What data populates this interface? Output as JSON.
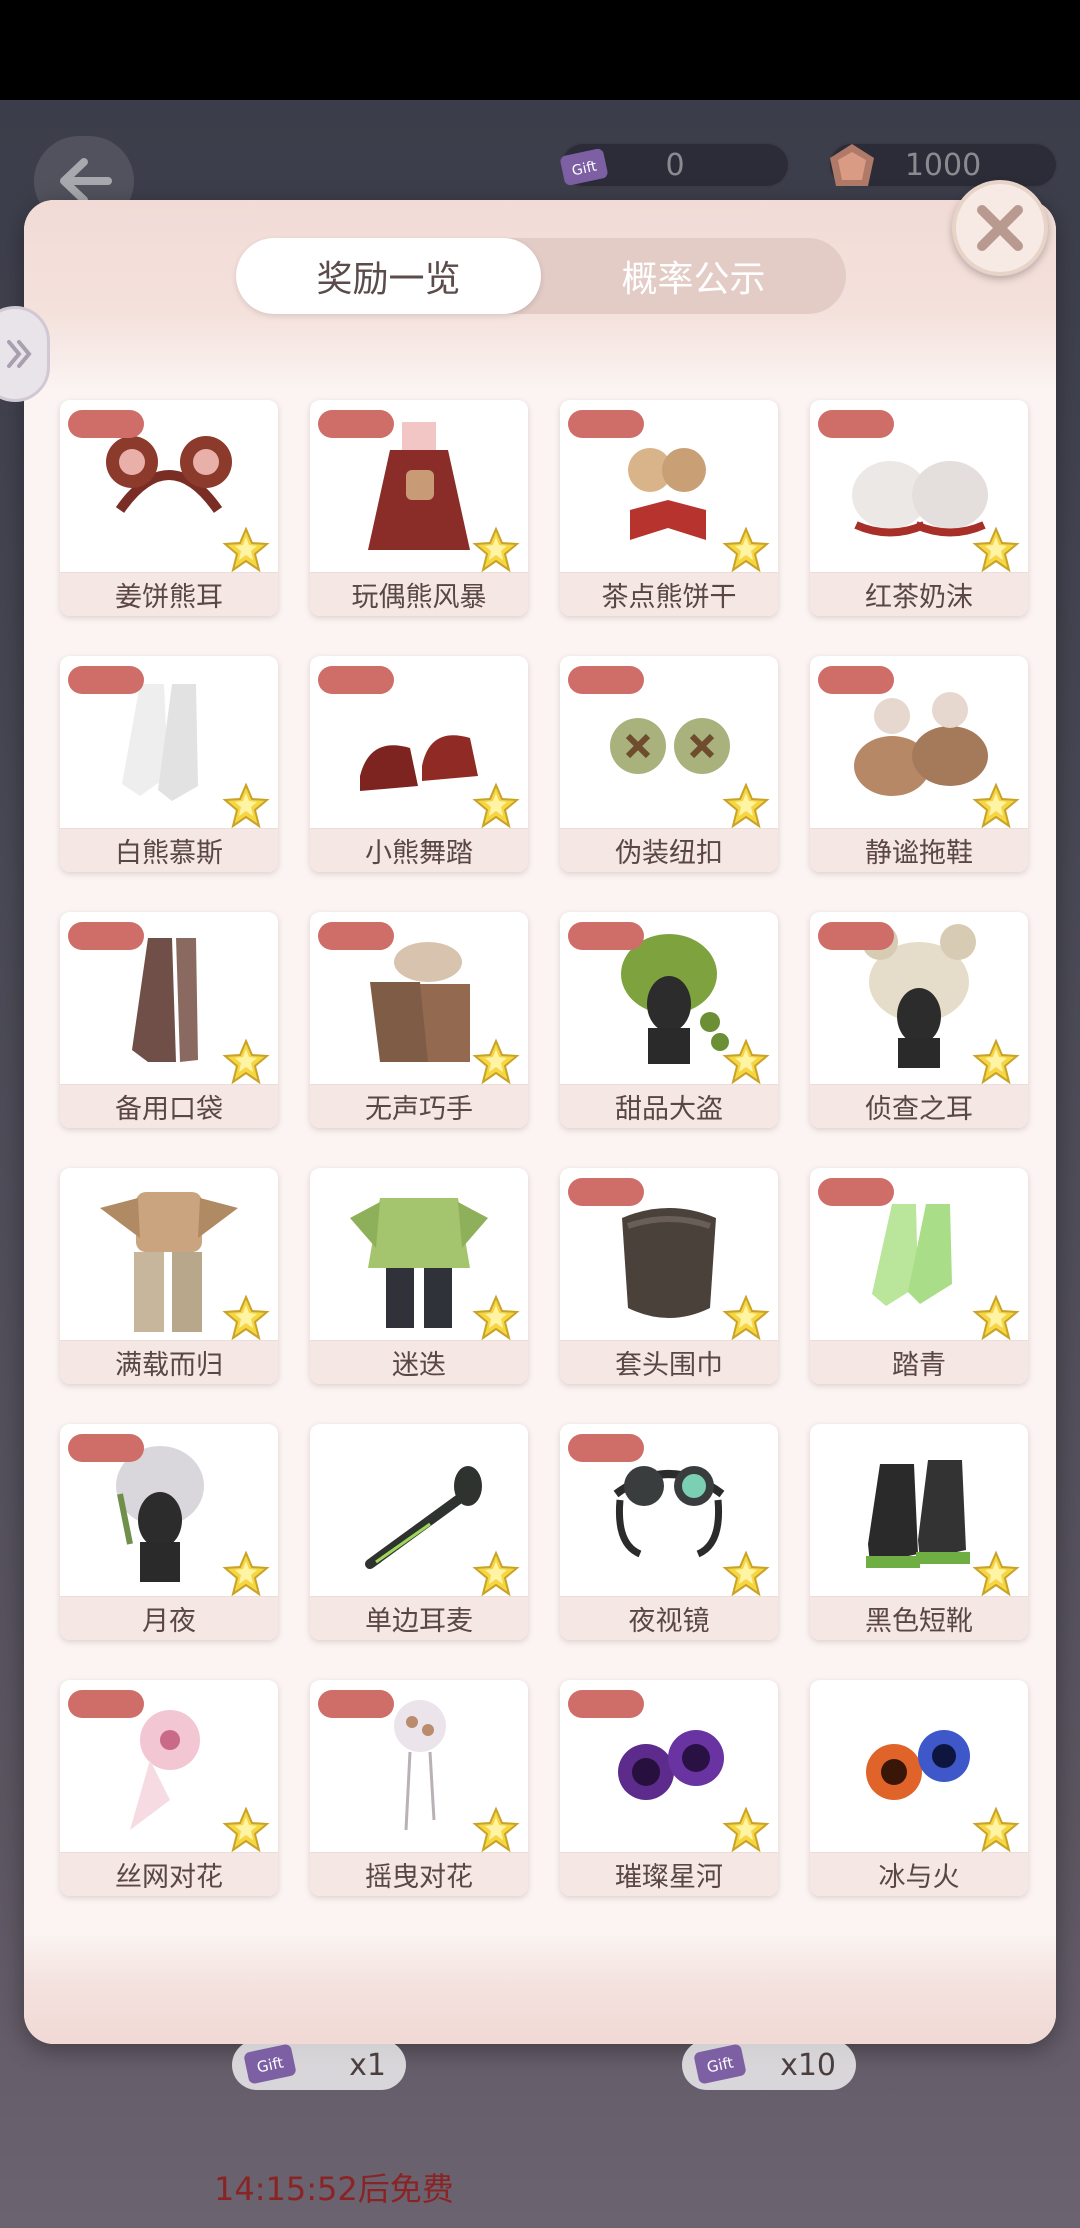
{
  "header": {
    "ticket_count": "0",
    "gem_count": "1000"
  },
  "tabs": [
    {
      "label": "奖励一览",
      "active": true
    },
    {
      "label": "概率公示",
      "active": false
    }
  ],
  "items": [
    {
      "name": "姜饼熊耳",
      "tag": true,
      "icon": "bear-ear-headband"
    },
    {
      "name": "玩偶熊风暴",
      "tag": true,
      "icon": "bear-dress"
    },
    {
      "name": "茶点熊饼干",
      "tag": true,
      "icon": "bear-cookie-earrings"
    },
    {
      "name": "红茶奶沫",
      "tag": true,
      "icon": "frilly-bloomers"
    },
    {
      "name": "白熊慕斯",
      "tag": true,
      "icon": "white-socks"
    },
    {
      "name": "小熊舞踏",
      "tag": true,
      "icon": "red-mary-janes"
    },
    {
      "name": "伪装纽扣",
      "tag": true,
      "icon": "green-buttons"
    },
    {
      "name": "静谧拖鞋",
      "tag": true,
      "icon": "bear-slippers"
    },
    {
      "name": "备用口袋",
      "tag": true,
      "icon": "striped-stockings"
    },
    {
      "name": "无声巧手",
      "tag": true,
      "icon": "fur-gloves"
    },
    {
      "name": "甜品大盗",
      "tag": true,
      "icon": "green-braid-wig"
    },
    {
      "name": "侦查之耳",
      "tag": true,
      "icon": "bear-hat"
    },
    {
      "name": "满载而归",
      "tag": false,
      "icon": "patchwork-outfit"
    },
    {
      "name": "迷迭",
      "tag": false,
      "icon": "green-jacket-outfit"
    },
    {
      "name": "套头围巾",
      "tag": true,
      "icon": "snood-scarf"
    },
    {
      "name": "踏青",
      "tag": true,
      "icon": "green-socks"
    },
    {
      "name": "月夜",
      "tag": true,
      "icon": "silver-hair-wig"
    },
    {
      "name": "单边耳麦",
      "tag": false,
      "icon": "headset-mic"
    },
    {
      "name": "夜视镜",
      "tag": true,
      "icon": "night-goggles"
    },
    {
      "name": "黑色短靴",
      "tag": false,
      "icon": "black-boots"
    },
    {
      "name": "丝网对花",
      "tag": true,
      "icon": "pink-flower-pin"
    },
    {
      "name": "摇曳对花",
      "tag": true,
      "icon": "dangle-flower-pin"
    },
    {
      "name": "璀璨星河",
      "tag": true,
      "icon": "purple-eyes"
    },
    {
      "name": "冰与火",
      "tag": false,
      "icon": "fire-ice-eyes"
    }
  ],
  "footer": {
    "draw_one_label": "x1",
    "draw_ten_label": "x10",
    "timer_text": "14:15:52后免费"
  }
}
